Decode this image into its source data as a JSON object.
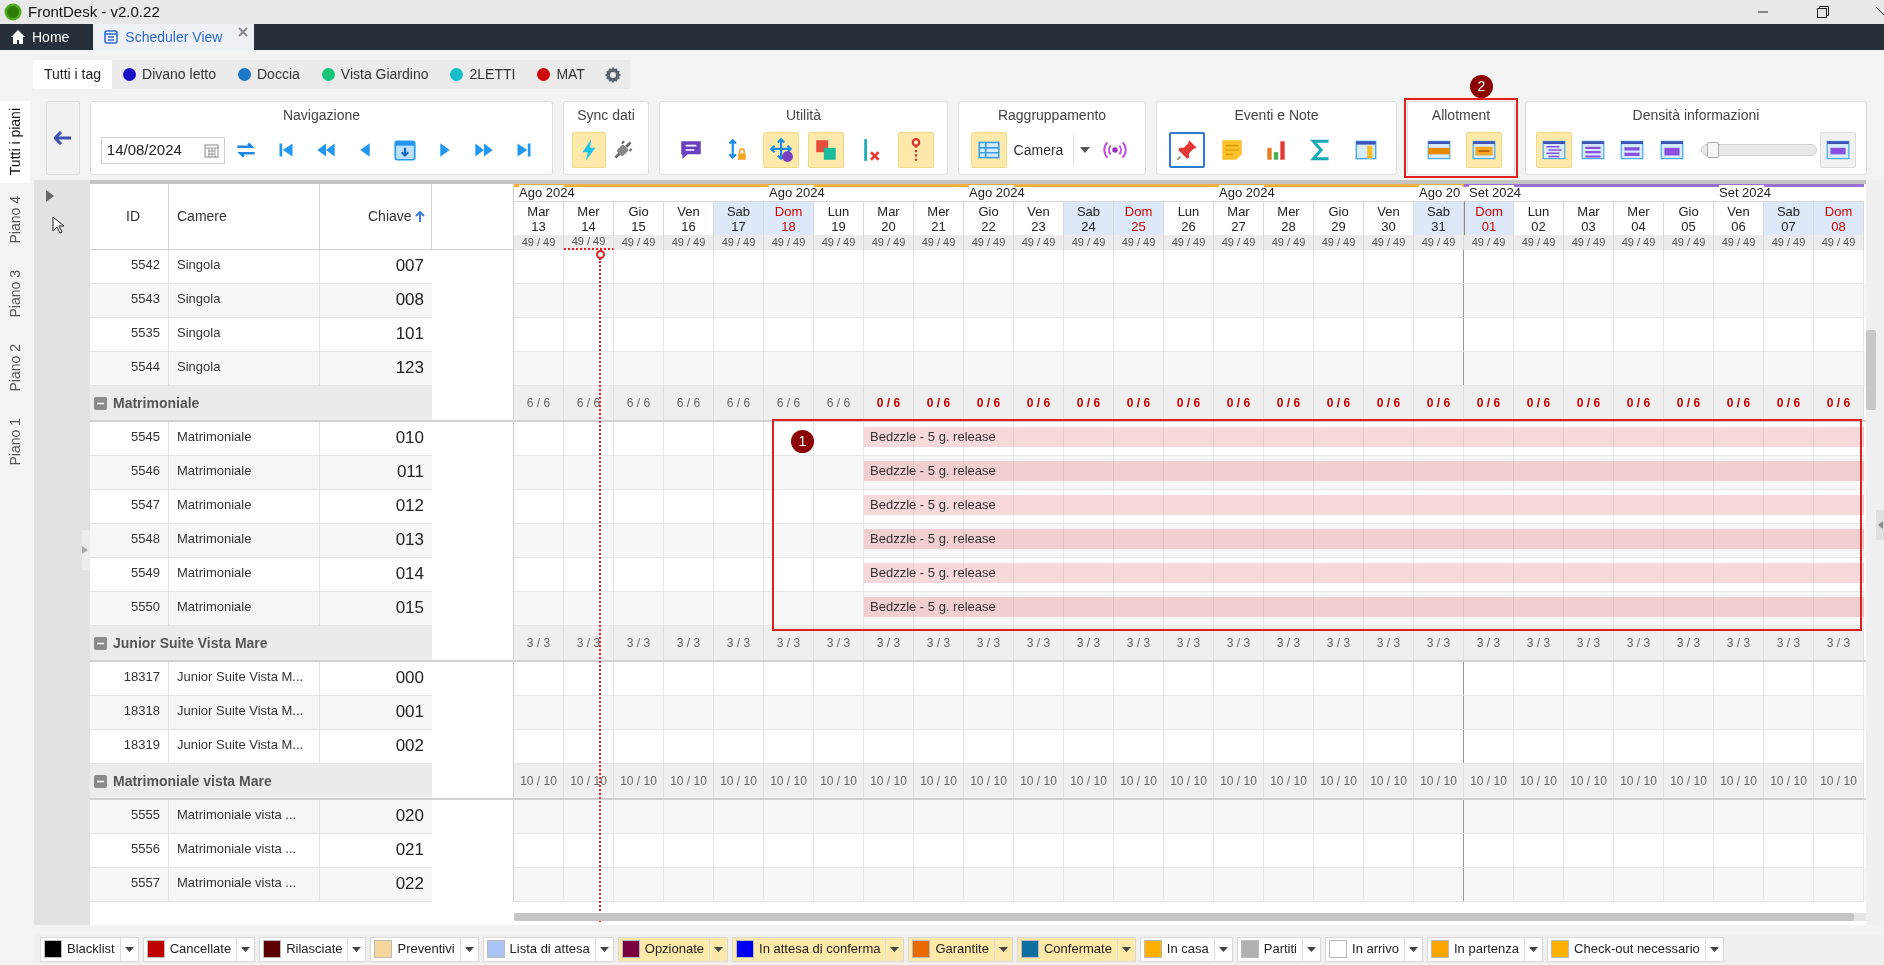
{
  "window": {
    "title": "FrontDesk - v2.0.22"
  },
  "doc_tabs": [
    {
      "label": "Home",
      "kind": "home",
      "selected": false
    },
    {
      "label": "Scheduler View",
      "kind": "scheduler",
      "selected": true,
      "closable": true
    }
  ],
  "tag_tabs": [
    {
      "label": "Tutti i tag",
      "selected": true
    },
    {
      "label": "Divano letto",
      "selected": false,
      "color": "#1a0fc8"
    },
    {
      "label": "Doccia",
      "selected": false,
      "color": "#1c78c8"
    },
    {
      "label": "Vista Giardino",
      "selected": false,
      "color": "#16c47a"
    },
    {
      "label": "2LETTI",
      "selected": false,
      "color": "#17bec8"
    },
    {
      "label": "MAT",
      "selected": false,
      "color": "#cc0a0a"
    }
  ],
  "floor_tabs": [
    {
      "label": "Tutti i piani",
      "selected": true
    },
    {
      "label": "Piano 4",
      "selected": false
    },
    {
      "label": "Piano 3",
      "selected": false
    },
    {
      "label": "Piano 2",
      "selected": false
    },
    {
      "label": "Piano 1",
      "selected": false
    }
  ],
  "toolbar": [
    {
      "title": "Navigazione",
      "date": "14/08/2024",
      "buttons": [
        {
          "kind": "refresh",
          "toggled": false
        },
        {
          "kind": "first",
          "toggled": false
        },
        {
          "kind": "fast-back",
          "toggled": false
        },
        {
          "kind": "back",
          "toggled": false
        },
        {
          "kind": "today",
          "toggled": false
        },
        {
          "kind": "forward",
          "toggled": false
        },
        {
          "kind": "fast-forward",
          "toggled": false
        },
        {
          "kind": "last",
          "toggled": false
        }
      ]
    },
    {
      "title": "Sync dati",
      "buttons": [
        {
          "kind": "bolt",
          "toggled": true
        },
        {
          "kind": "plug",
          "toggled": false
        }
      ]
    },
    {
      "title": "Utilità",
      "buttons": [
        {
          "kind": "comment",
          "toggled": false
        },
        {
          "kind": "resize-lock",
          "toggled": false
        },
        {
          "kind": "move-help",
          "toggled": true
        },
        {
          "kind": "swap",
          "toggled": true
        },
        {
          "kind": "line-delete",
          "toggled": false
        },
        {
          "kind": "pin-line",
          "toggled": true
        }
      ]
    },
    {
      "title": "Raggruppamento",
      "buttons": [
        {
          "kind": "table",
          "toggled": true
        },
        {
          "kind": "select",
          "value": "Camera"
        },
        {
          "kind": "broadcast",
          "toggled": false
        }
      ]
    },
    {
      "title": "Eventi e Note",
      "buttons": [
        {
          "kind": "pin",
          "toggled": false,
          "focused": true
        },
        {
          "kind": "note",
          "toggled": false,
          "focused": false
        },
        {
          "kind": "chart",
          "toggled": false,
          "focused": false
        },
        {
          "kind": "sigma",
          "toggled": false,
          "focused": false
        },
        {
          "kind": "columns",
          "toggled": false,
          "focused": false
        }
      ]
    },
    {
      "title": "Allotment",
      "buttons": [
        {
          "kind": "allot-bar",
          "toggled": false
        },
        {
          "kind": "allot-text",
          "toggled": true
        }
      ]
    },
    {
      "title": "Densità informazioni",
      "buttons": [
        {
          "kind": "density-1",
          "toggled": true
        },
        {
          "kind": "density-2",
          "toggled": false
        },
        {
          "kind": "density-3",
          "toggled": false
        },
        {
          "kind": "density-4",
          "toggled": false
        },
        {
          "kind": "slider",
          "level": 0.05
        },
        {
          "kind": "density-5",
          "toggled": false
        }
      ]
    }
  ],
  "table": {
    "columns": [
      {
        "label": "ID"
      },
      {
        "label": "Camere"
      },
      {
        "label": "Chiave",
        "sorted": true
      }
    ]
  },
  "days": [
    {
      "dow": "Mar",
      "d": "13",
      "kind": "weekday",
      "color": "#f5b041",
      "month": "Ago 2024",
      "total": "49 / 49",
      "today": false
    },
    {
      "dow": "Mer",
      "d": "14",
      "kind": "weekday",
      "color": "#f5b041",
      "total": "49 / 49",
      "today": true
    },
    {
      "dow": "Gio",
      "d": "15",
      "kind": "weekday",
      "color": "#f5b041",
      "total": "49 / 49",
      "today": false
    },
    {
      "dow": "Ven",
      "d": "16",
      "kind": "weekday",
      "color": "#f5b041",
      "total": "49 / 49",
      "today": false
    },
    {
      "dow": "Sab",
      "d": "17",
      "kind": "saturday",
      "color": "#f5b041",
      "total": "49 / 49",
      "today": false
    },
    {
      "dow": "Dom",
      "d": "18",
      "kind": "sunday",
      "color": "#f5b041",
      "month": "Ago 2024",
      "total": "49 / 49",
      "today": false
    },
    {
      "dow": "Lun",
      "d": "19",
      "kind": "weekday",
      "color": "#f5b041",
      "total": "49 / 49",
      "today": false
    },
    {
      "dow": "Mar",
      "d": "20",
      "kind": "weekday",
      "color": "#f5b041",
      "total": "49 / 49",
      "today": false
    },
    {
      "dow": "Mer",
      "d": "21",
      "kind": "weekday",
      "color": "#f5b041",
      "total": "49 / 49",
      "today": false
    },
    {
      "dow": "Gio",
      "d": "22",
      "kind": "weekday",
      "color": "#f5b041",
      "month": "Ago 2024",
      "total": "49 / 49",
      "today": false
    },
    {
      "dow": "Ven",
      "d": "23",
      "kind": "weekday",
      "color": "#f5b041",
      "total": "49 / 49",
      "today": false
    },
    {
      "dow": "Sab",
      "d": "24",
      "kind": "saturday",
      "color": "#f5b041",
      "total": "49 / 49",
      "today": false
    },
    {
      "dow": "Dom",
      "d": "25",
      "kind": "sunday",
      "color": "#f5b041",
      "total": "49 / 49",
      "today": false
    },
    {
      "dow": "Lun",
      "d": "26",
      "kind": "weekday",
      "color": "#f5b041",
      "total": "49 / 49",
      "today": false
    },
    {
      "dow": "Mar",
      "d": "27",
      "kind": "weekday",
      "color": "#f5b041",
      "month": "Ago 2024",
      "total": "49 / 49",
      "today": false
    },
    {
      "dow": "Mer",
      "d": "28",
      "kind": "weekday",
      "color": "#f5b041",
      "total": "49 / 49",
      "today": false
    },
    {
      "dow": "Gio",
      "d": "29",
      "kind": "weekday",
      "color": "#f5b041",
      "total": "49 / 49",
      "today": false
    },
    {
      "dow": "Ven",
      "d": "30",
      "kind": "weekday",
      "color": "#f5b041",
      "total": "49 / 49",
      "today": false
    },
    {
      "dow": "Sab",
      "d": "31",
      "kind": "saturday",
      "color": "#f5b041",
      "month": "Ago 20",
      "total": "49 / 49",
      "today": false
    },
    {
      "dow": "Dom",
      "d": "01",
      "kind": "sunday",
      "color": "#9b6fd6",
      "month": "Set 2024",
      "total": "49 / 49",
      "today": false
    },
    {
      "dow": "Lun",
      "d": "02",
      "kind": "weekday",
      "color": "#9b6fd6",
      "total": "49 / 49",
      "today": false
    },
    {
      "dow": "Mar",
      "d": "03",
      "kind": "weekday",
      "color": "#9b6fd6",
      "total": "49 / 49",
      "today": false
    },
    {
      "dow": "Mer",
      "d": "04",
      "kind": "weekday",
      "color": "#9b6fd6",
      "total": "49 / 49",
      "today": false
    },
    {
      "dow": "Gio",
      "d": "05",
      "kind": "weekday",
      "color": "#9b6fd6",
      "total": "49 / 49",
      "today": false
    },
    {
      "dow": "Ven",
      "d": "06",
      "kind": "weekday",
      "color": "#9b6fd6",
      "month": "Set 2024",
      "total": "49 / 49",
      "today": false
    },
    {
      "dow": "Sab",
      "d": "07",
      "kind": "saturday",
      "color": "#9b6fd6",
      "total": "49 / 49",
      "today": false
    },
    {
      "dow": "Dom",
      "d": "08",
      "kind": "sunday",
      "color": "#9b6fd6",
      "total": "49 / 49",
      "today": false
    }
  ],
  "sections": [
    {
      "rows": [
        {
          "id": "5542",
          "room": "Singola",
          "key": "007"
        },
        {
          "id": "5543",
          "room": "Singola",
          "key": "008"
        },
        {
          "id": "5535",
          "room": "Singola",
          "key": "101"
        },
        {
          "id": "5544",
          "room": "Singola",
          "key": "123"
        }
      ]
    },
    {
      "name": "Matrimoniale",
      "expanded": true,
      "counts": [
        {
          "t": "6 / 6",
          "full": false
        },
        {
          "t": "6 / 6",
          "full": false
        },
        {
          "t": "6 / 6",
          "full": false
        },
        {
          "t": "6 / 6",
          "full": false
        },
        {
          "t": "6 / 6",
          "full": false
        },
        {
          "t": "6 / 6",
          "full": false
        },
        {
          "t": "6 / 6",
          "full": false
        },
        {
          "t": "0 / 6",
          "full": true
        },
        {
          "t": "0 / 6",
          "full": true
        },
        {
          "t": "0 / 6",
          "full": true
        },
        {
          "t": "0 / 6",
          "full": true
        },
        {
          "t": "0 / 6",
          "full": true
        },
        {
          "t": "0 / 6",
          "full": true
        },
        {
          "t": "0 / 6",
          "full": true
        },
        {
          "t": "0 / 6",
          "full": true
        },
        {
          "t": "0 / 6",
          "full": true
        },
        {
          "t": "0 / 6",
          "full": true
        },
        {
          "t": "0 / 6",
          "full": true
        },
        {
          "t": "0 / 6",
          "full": true
        },
        {
          "t": "0 / 6",
          "full": true
        },
        {
          "t": "0 / 6",
          "full": true
        },
        {
          "t": "0 / 6",
          "full": true
        },
        {
          "t": "0 / 6",
          "full": true
        },
        {
          "t": "0 / 6",
          "full": true
        },
        {
          "t": "0 / 6",
          "full": true
        },
        {
          "t": "0 / 6",
          "full": true
        },
        {
          "t": "0 / 6",
          "full": true
        }
      ],
      "rows": [
        {
          "id": "5545",
          "room": "Matrimoniale",
          "key": "010",
          "allotment_label": "Bedzzle - 5 g. release"
        },
        {
          "id": "5546",
          "room": "Matrimoniale",
          "key": "011",
          "allotment_label": "Bedzzle - 5 g. release"
        },
        {
          "id": "5547",
          "room": "Matrimoniale",
          "key": "012",
          "allotment_label": "Bedzzle - 5 g. release"
        },
        {
          "id": "5548",
          "room": "Matrimoniale",
          "key": "013",
          "allotment_label": "Bedzzle - 5 g. release"
        },
        {
          "id": "5549",
          "room": "Matrimoniale",
          "key": "014",
          "allotment_label": "Bedzzle - 5 g. release"
        },
        {
          "id": "5550",
          "room": "Matrimoniale",
          "key": "015",
          "allotment_label": "Bedzzle - 5 g. release"
        }
      ]
    },
    {
      "name": "Junior Suite Vista Mare",
      "expanded": true,
      "counts": [
        {
          "t": "3 / 3",
          "full": false
        },
        {
          "t": "3 / 3",
          "full": false
        },
        {
          "t": "3 / 3",
          "full": false
        },
        {
          "t": "3 / 3",
          "full": false
        },
        {
          "t": "3 / 3",
          "full": false
        },
        {
          "t": "3 / 3",
          "full": false
        },
        {
          "t": "3 / 3",
          "full": false
        },
        {
          "t": "3 / 3",
          "full": false
        },
        {
          "t": "3 / 3",
          "full": false
        },
        {
          "t": "3 / 3",
          "full": false
        },
        {
          "t": "3 / 3",
          "full": false
        },
        {
          "t": "3 / 3",
          "full": false
        },
        {
          "t": "3 / 3",
          "full": false
        },
        {
          "t": "3 / 3",
          "full": false
        },
        {
          "t": "3 / 3",
          "full": false
        },
        {
          "t": "3 / 3",
          "full": false
        },
        {
          "t": "3 / 3",
          "full": false
        },
        {
          "t": "3 / 3",
          "full": false
        },
        {
          "t": "3 / 3",
          "full": false
        },
        {
          "t": "3 / 3",
          "full": false
        },
        {
          "t": "3 / 3",
          "full": false
        },
        {
          "t": "3 / 3",
          "full": false
        },
        {
          "t": "3 / 3",
          "full": false
        },
        {
          "t": "3 / 3",
          "full": false
        },
        {
          "t": "3 / 3",
          "full": false
        },
        {
          "t": "3 / 3",
          "full": false
        },
        {
          "t": "3 / 3",
          "full": false
        }
      ],
      "rows": [
        {
          "id": "18317",
          "room": "Junior Suite Vista M...",
          "key": "000"
        },
        {
          "id": "18318",
          "room": "Junior Suite Vista M...",
          "key": "001"
        },
        {
          "id": "18319",
          "room": "Junior Suite Vista M...",
          "key": "002"
        }
      ]
    },
    {
      "name": "Matrimoniale vista Mare",
      "expanded": true,
      "counts": [
        {
          "t": "10 / 10",
          "full": false
        },
        {
          "t": "10 / 10",
          "full": false
        },
        {
          "t": "10 / 10",
          "full": false
        },
        {
          "t": "10 / 10",
          "full": false
        },
        {
          "t": "10 / 10",
          "full": false
        },
        {
          "t": "10 / 10",
          "full": false
        },
        {
          "t": "10 / 10",
          "full": false
        },
        {
          "t": "10 / 10",
          "full": false
        },
        {
          "t": "10 / 10",
          "full": false
        },
        {
          "t": "10 / 10",
          "full": false
        },
        {
          "t": "10 / 10",
          "full": false
        },
        {
          "t": "10 / 10",
          "full": false
        },
        {
          "t": "10 / 10",
          "full": false
        },
        {
          "t": "10 / 10",
          "full": false
        },
        {
          "t": "10 / 10",
          "full": false
        },
        {
          "t": "10 / 10",
          "full": false
        },
        {
          "t": "10 / 10",
          "full": false
        },
        {
          "t": "10 / 10",
          "full": false
        },
        {
          "t": "10 / 10",
          "full": false
        },
        {
          "t": "10 / 10",
          "full": false
        },
        {
          "t": "10 / 10",
          "full": false
        },
        {
          "t": "10 / 10",
          "full": false
        },
        {
          "t": "10 / 10",
          "full": false
        },
        {
          "t": "10 / 10",
          "full": false
        },
        {
          "t": "10 / 10",
          "full": false
        },
        {
          "t": "10 / 10",
          "full": false
        },
        {
          "t": "10 / 10",
          "full": false
        }
      ],
      "rows": [
        {
          "id": "5555",
          "room": "Matrimoniale vista ...",
          "key": "020"
        },
        {
          "id": "5556",
          "room": "Matrimoniale vista ...",
          "key": "021"
        },
        {
          "id": "5557",
          "room": "Matrimoniale vista ...",
          "key": "022"
        }
      ]
    }
  ],
  "annotations": [
    {
      "label": "1"
    },
    {
      "label": "2"
    }
  ],
  "legend": [
    {
      "label": "Blacklist",
      "color": "#000000",
      "selected": false
    },
    {
      "label": "Cancellate",
      "color": "#c00000",
      "selected": false
    },
    {
      "label": "Rilasciate",
      "color": "#5a0000",
      "selected": false
    },
    {
      "label": "Preventivi",
      "color": "#f5d79e",
      "selected": false
    },
    {
      "label": "Lista di attesa",
      "color": "#a9c4f5",
      "selected": false
    },
    {
      "label": "Opzionate",
      "color": "#7a0040",
      "selected": true
    },
    {
      "label": "In attesa di conferma",
      "color": "#0000ee",
      "selected": true
    },
    {
      "label": "Garantite",
      "color": "#e86a00",
      "selected": true
    },
    {
      "label": "Confermate",
      "color": "#0e6ea0",
      "selected": true
    },
    {
      "label": "In casa",
      "color": "#ffb000",
      "selected": false
    },
    {
      "label": "Partiti",
      "color": "#b0b0b0",
      "selected": false
    },
    {
      "label": "In arrivo",
      "color": "#ffffff",
      "selected": false
    },
    {
      "label": "In partenza",
      "color": "#ffa500",
      "selected": false
    },
    {
      "label": "Check-out necessario",
      "color": "#ffb000",
      "selected": false
    }
  ]
}
